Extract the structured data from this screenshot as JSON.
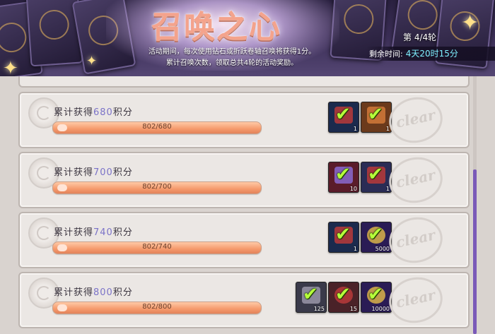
{
  "banner": {
    "title": "召唤之心",
    "desc_line1": "活动期间，每次使用钻石或折跃卷轴召唤将获得1分。",
    "desc_line2": "累计召唤次数，领取总共4轮的活动奖励。",
    "round": "第 4/4轮",
    "remaining_label": "剩余时间:",
    "remaining_time": "4天20时15分"
  },
  "tasks": [
    {
      "label_prefix": "累计获得",
      "points": "680",
      "label_suffix": "积分",
      "progress_text": "802/680",
      "progress": 1.0,
      "status": "clear",
      "rewards": [
        {
          "icon": "red-gem-icon",
          "qty": "1",
          "bg": "#1b2a4d",
          "tint": "#b83a3a"
        },
        {
          "icon": "crafting-material-icon",
          "qty": "1",
          "bg": "#6b3a1c",
          "tint": "#d27a3a"
        }
      ]
    },
    {
      "label_prefix": "累计获得",
      "points": "700",
      "label_suffix": "积分",
      "progress_text": "802/700",
      "progress": 1.0,
      "status": "clear",
      "rewards": [
        {
          "icon": "purple-crystal-icon",
          "qty": "10",
          "bg": "#5a1c2a",
          "tint": "#8a6ad0"
        },
        {
          "icon": "red-gem-icon",
          "qty": "1",
          "bg": "#2a2c55",
          "tint": "#b83a3a"
        }
      ]
    },
    {
      "label_prefix": "累计获得",
      "points": "740",
      "label_suffix": "积分",
      "progress_text": "802/740",
      "progress": 1.0,
      "status": "clear",
      "rewards": [
        {
          "icon": "red-gem-icon",
          "qty": "1",
          "bg": "#1b2a4d",
          "tint": "#b83a3a"
        },
        {
          "icon": "gold-coin-icon",
          "qty": "5000",
          "bg": "#2a1c55",
          "tint": "#d9b34a"
        }
      ]
    },
    {
      "label_prefix": "累计获得",
      "points": "800",
      "label_suffix": "积分",
      "progress_text": "802/800",
      "progress": 1.0,
      "status": "clear",
      "rewards": [
        {
          "icon": "ore-stone-icon",
          "qty": "125",
          "bg": "#3a3a4a",
          "tint": "#9a96a8"
        },
        {
          "icon": "red-gem-icon",
          "qty": "15",
          "bg": "#4a2228",
          "tint": "#b83a3a"
        },
        {
          "icon": "gold-coin-icon",
          "qty": "10000",
          "bg": "#2a1c55",
          "tint": "#d9b34a"
        }
      ]
    }
  ],
  "clear_text": "clear",
  "colors": {
    "points_accent": "#7b73c8",
    "remaining_accent": "#7ff0ff",
    "progress_bar": "#f59a6c",
    "check": "#b5ff3a"
  }
}
